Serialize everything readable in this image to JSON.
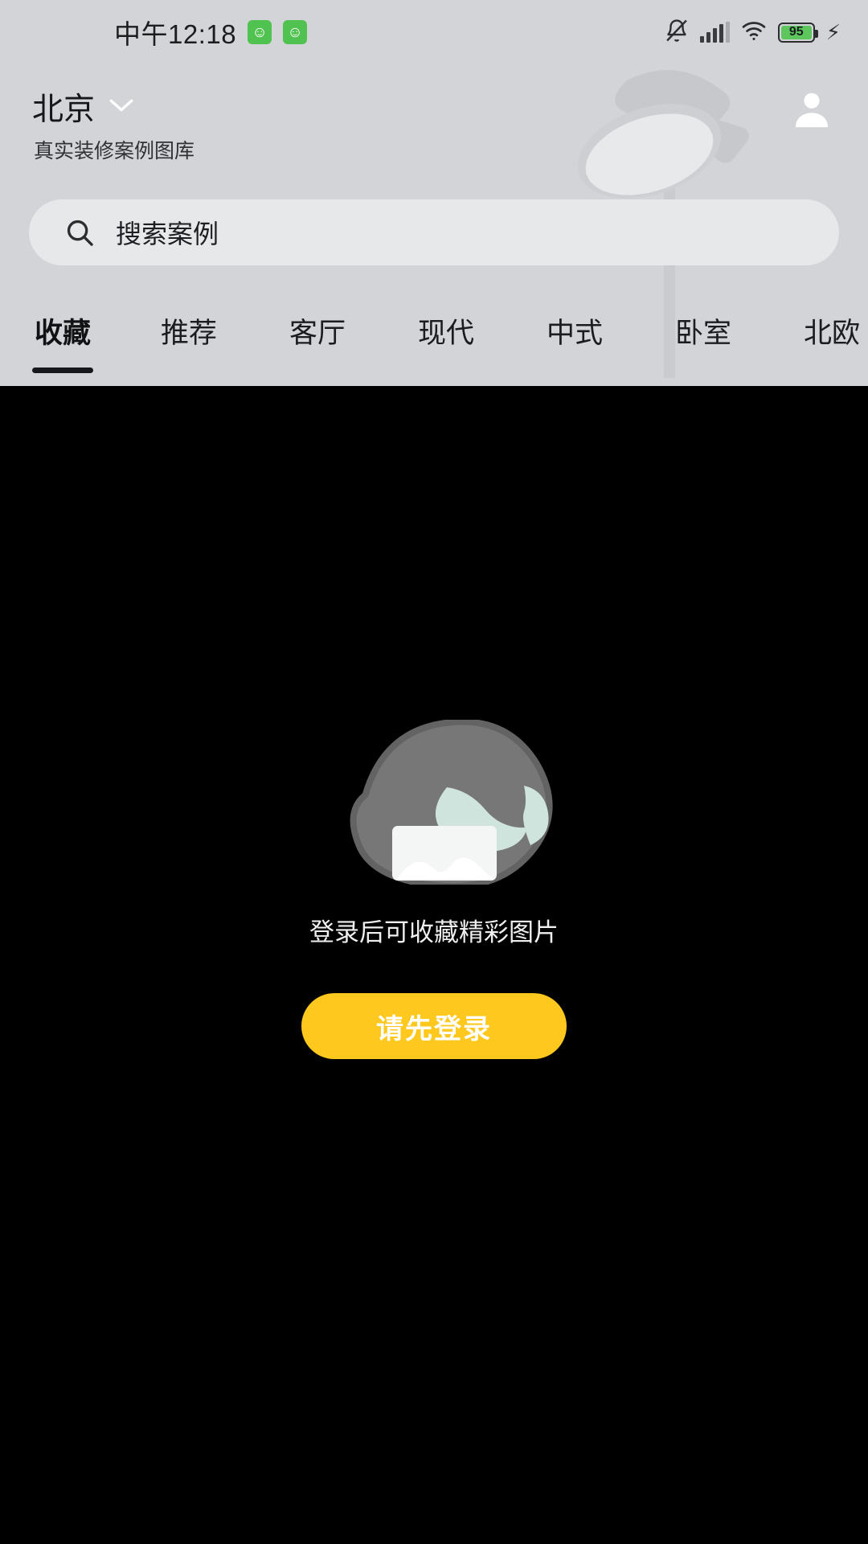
{
  "status_bar": {
    "clock": "中午12:18",
    "notification_badges": [
      "☺",
      "☺"
    ],
    "icons": [
      "bell-muted-icon",
      "signal-bars-icon",
      "wifi-icon",
      "battery-icon",
      "charging-bolt-icon"
    ],
    "battery_percent": "95",
    "battery_color": "#5dc75d"
  },
  "header": {
    "city": "北京",
    "city_chevron": "chevron-down-icon",
    "subtitle": "真实装修案例图库",
    "avatar": "person-icon",
    "background_decoration": "desk-lamp-illustration",
    "background_color": "#d2d4d7"
  },
  "search": {
    "icon": "search-icon",
    "placeholder": "搜索案例",
    "value": "",
    "background_color": "#e6e8ea"
  },
  "tabs": {
    "active_index": 0,
    "items": [
      {
        "label": "收藏"
      },
      {
        "label": "推荐"
      },
      {
        "label": "客厅"
      },
      {
        "label": "现代"
      },
      {
        "label": "中式"
      },
      {
        "label": "卧室"
      },
      {
        "label": "北欧"
      }
    ]
  },
  "empty_state": {
    "illustration": "empty-favorites-illustration",
    "message": "登录后可收藏精彩图片",
    "button_label": "请先登录",
    "button_color": "#FFC81E",
    "background_color": "#000000"
  }
}
